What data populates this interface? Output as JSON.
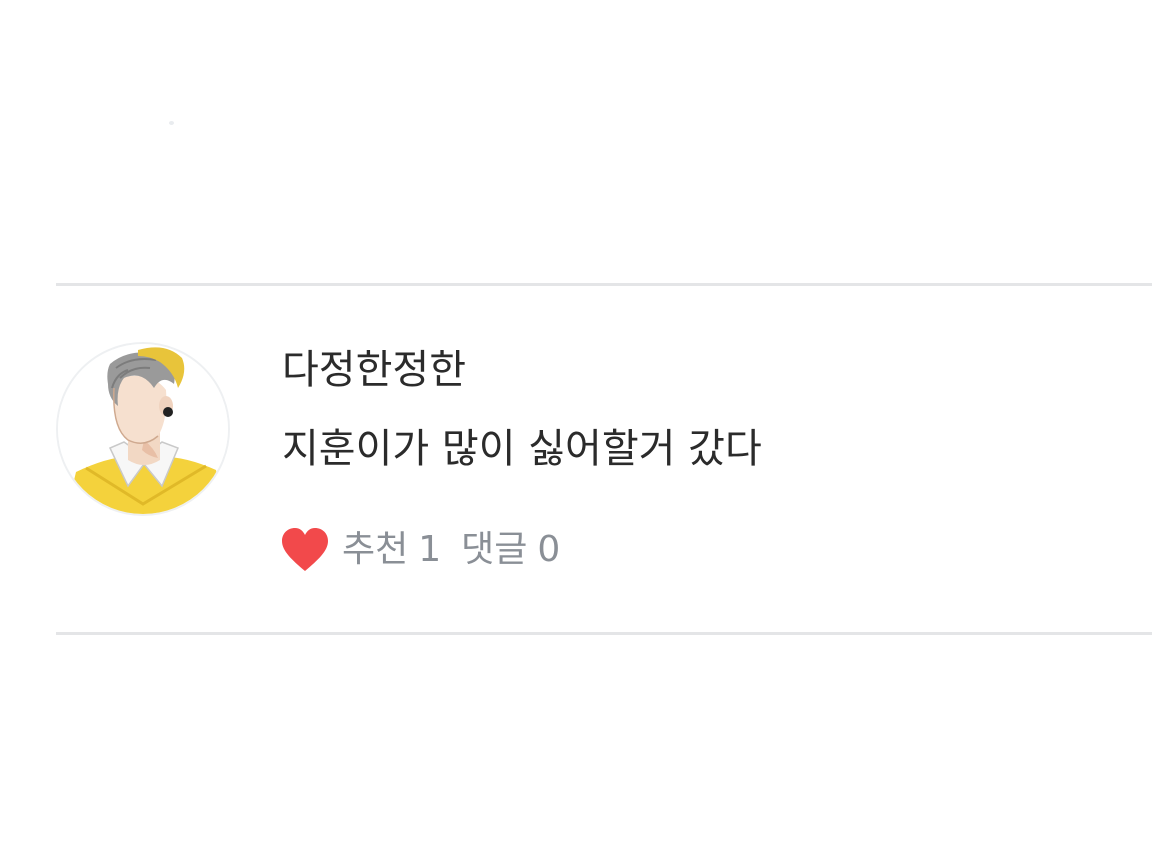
{
  "comment": {
    "author": "다정한정한",
    "text": "지훈이가 많이 싫어할거 갔다",
    "like_label": "추천",
    "like_count": "1",
    "reply_label": "댓글",
    "reply_count": "0"
  },
  "icons": {
    "like": "heart-icon",
    "avatar": "illustrated-profile-avatar"
  },
  "colors": {
    "heart": "#f2494b",
    "meta_text": "#8a8f96",
    "body_text": "#2b2b2b",
    "divider": "#e4e5e7",
    "avatar_sweater": "#f4d23c"
  }
}
